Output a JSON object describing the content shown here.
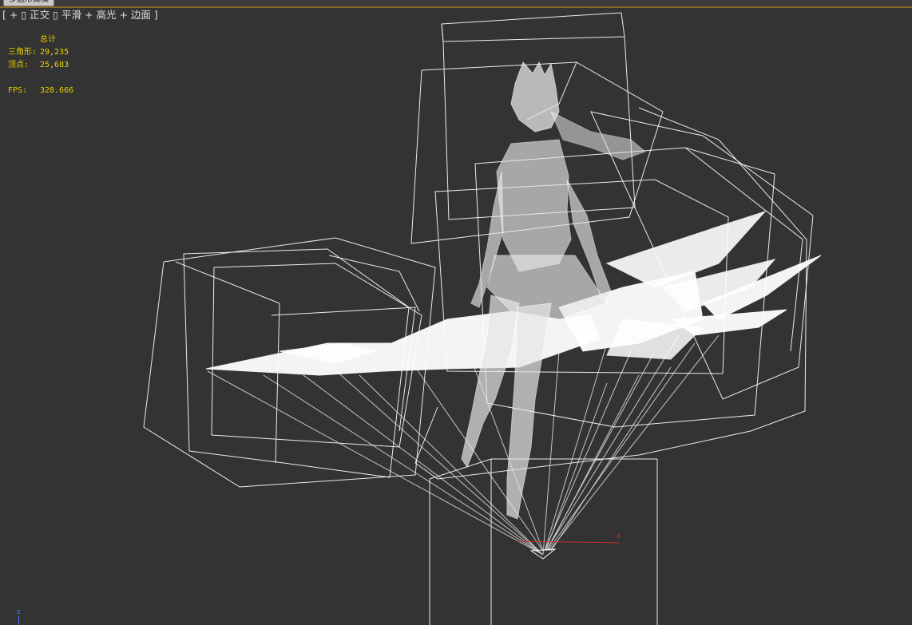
{
  "window": {
    "mode_tab": "多边形建模"
  },
  "viewport_label": {
    "open": "[ ",
    "plus1": "+",
    "box1": " ▯ ",
    "view": "正交",
    "box2": " ▯ ",
    "shading": "平滑",
    "plus2": " + ",
    "highlight": "高光",
    "plus3": " + ",
    "edges": "边面",
    "close": " ]"
  },
  "stats": {
    "title": "总计",
    "triangles_label": "三角形:",
    "triangles_value": "29,235",
    "vertices_label": "顶点:",
    "vertices_value": "25,683",
    "fps_label": "FPS:",
    "fps_value": "328.666"
  },
  "axis": {
    "z_label": "z",
    "x_label": "x"
  },
  "colors": {
    "background": "#333333",
    "wireframe": "#ffffff",
    "stats_text": "#e8d000",
    "z_axis": "#4a7bff",
    "x_axis": "#c83232"
  }
}
